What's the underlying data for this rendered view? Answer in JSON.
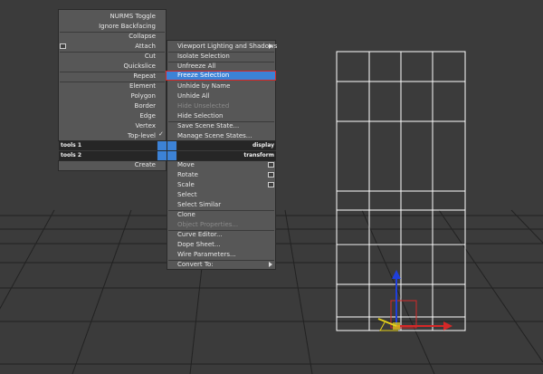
{
  "quad_top_left": {
    "items": [
      "NURMS Toggle",
      "Ignore Backfacing",
      "Collapse",
      "Attach",
      "Cut",
      "Quickslice",
      "Repeat",
      "Element",
      "Polygon",
      "Border",
      "Edge",
      "Vertex",
      "Top-level"
    ]
  },
  "quad_top_right": {
    "items": [
      "Viewport Lighting and Shadows",
      "Isolate Selection",
      "Unfreeze All",
      "Freeze Selection",
      "Unhide by Name",
      "Unhide All",
      "Hide Unselected",
      "Hide Selection",
      "Save Scene State...",
      "Manage Scene States..."
    ]
  },
  "quad_bottom_left": {
    "items": [
      "Create"
    ]
  },
  "quad_bottom_right": {
    "items": [
      "Move",
      "Rotate",
      "Scale",
      "Select",
      "Select Similar",
      "Clone",
      "Object Properties...",
      "Curve Editor...",
      "Dope Sheet...",
      "Wire Parameters...",
      "Convert To:"
    ]
  },
  "headers": {
    "tools1": "tools 1",
    "tools2": "tools 2",
    "display": "display",
    "transform": "transform"
  },
  "colors": {
    "viewport_bg": "#3b3b3b",
    "menu_bg": "#575757",
    "highlight": "#3c82d6",
    "highlight_border": "#d62828",
    "gizmo_x": "#d62828",
    "gizmo_y": "#2bb02b",
    "gizmo_z": "#1f3fdc"
  }
}
